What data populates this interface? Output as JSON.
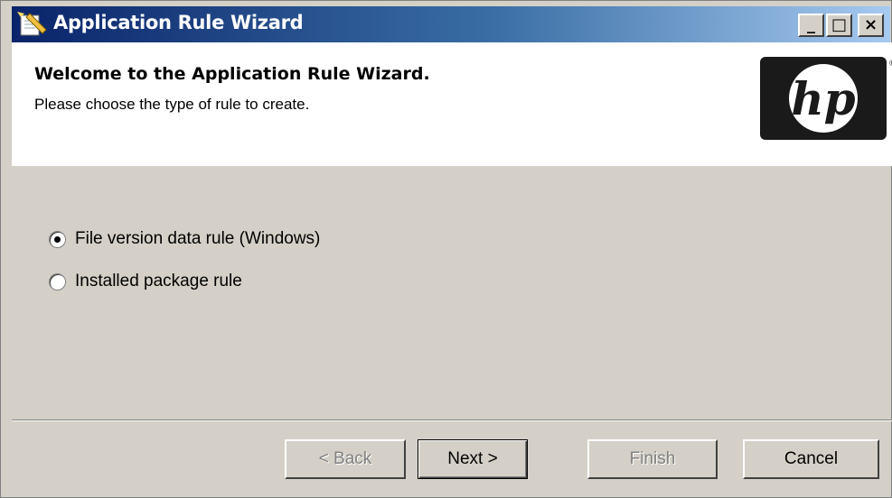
{
  "window": {
    "title": "Application Rule Wizard",
    "controls": {
      "minimize": "_",
      "maximize": "□",
      "close": "×"
    }
  },
  "header": {
    "title": "Welcome to the Application Rule Wizard.",
    "subtitle": "Please choose the type of rule to create.",
    "logo_text": "hp"
  },
  "options": [
    {
      "label": "File version data rule (Windows)",
      "checked": true
    },
    {
      "label": "Installed package rule",
      "checked": false
    }
  ],
  "buttons": {
    "back": "< Back",
    "next": "Next >",
    "finish": "Finish",
    "cancel": "Cancel"
  },
  "colors": {
    "titlebar_start": "#0a246a",
    "titlebar_end": "#a6caf0",
    "face": "#d4d0c8"
  },
  "icons": [
    "wizard-icon",
    "minimize-icon",
    "maximize-icon",
    "close-icon",
    "hp-logo"
  ]
}
